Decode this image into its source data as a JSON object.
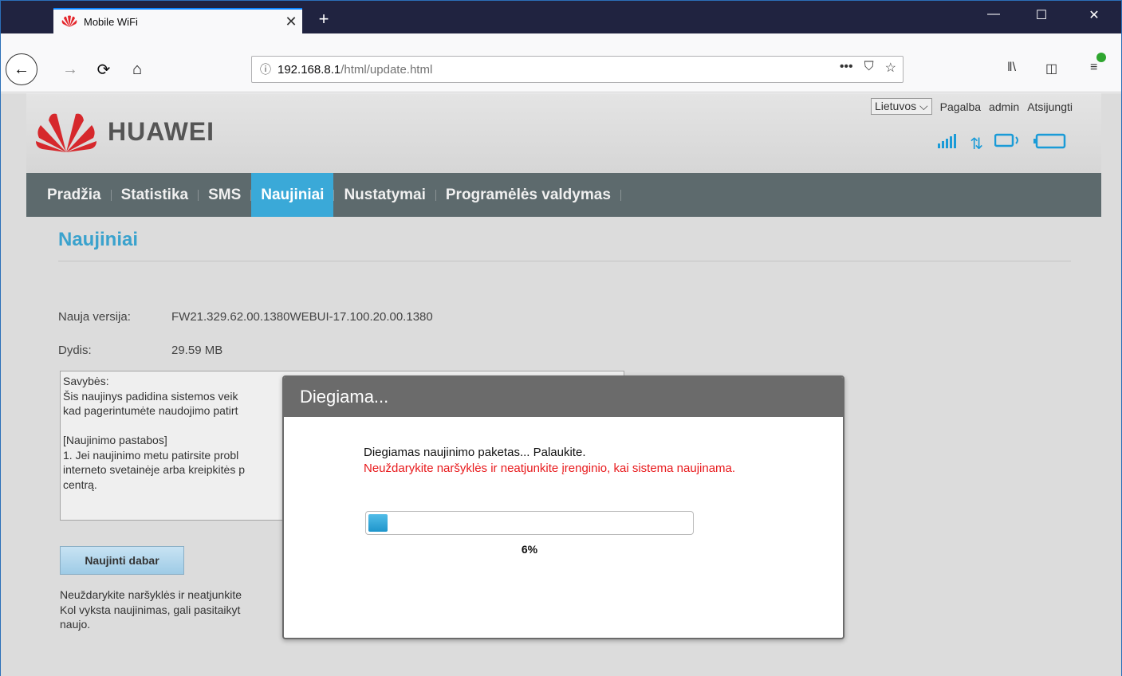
{
  "browser": {
    "tab_title": "Mobile WiFi",
    "url_host": "192.168.8.1",
    "url_path": "/html/update.html"
  },
  "router": {
    "brand": "HUAWEI",
    "language": "Lietuvos",
    "links": [
      "Pagalba",
      "admin",
      "Atsijungti"
    ],
    "menu": [
      {
        "label": "Pradžia",
        "active": false
      },
      {
        "label": "Statistika",
        "active": false
      },
      {
        "label": "SMS",
        "active": false
      },
      {
        "label": "Naujiniai",
        "active": true
      },
      {
        "label": "Nustatymai",
        "active": false
      },
      {
        "label": "Programėlės valdymas",
        "active": false
      }
    ],
    "page_title": "Naujiniai",
    "new_version_label": "Nauja versija:",
    "new_version_value": "FW21.329.62.00.1380WEBUI-17.100.20.00.1380",
    "size_label": "Dydis:",
    "size_value": "29.59 MB",
    "features_text": "Savybės:\nŠis naujinys padidina sistemos veik\nkad pagerintumėte naudojimo patirt\n\n[Naujinimo pastabos]\n1. Jei naujinimo metu patirsite probl\ninterneto svetainėje arba kreipkitės p\ncentrą.",
    "update_button": "Naujinti dabar",
    "warning_text": "Neuždarykite naršyklės ir neatjunkite\nKol vyksta naujinimas, gali pasitaikyt\nnaujo."
  },
  "modal": {
    "title": "Diegiama...",
    "message": "Diegiamas naujinimo paketas... Palaukite.",
    "warning": "Neuždarykite naršyklės ir neatjunkite įrenginio, kai sistema naujinama.",
    "progress_percent": 6,
    "progress_label": "6%"
  },
  "colors": {
    "accent": "#3aa9d8",
    "warning": "#e8191c",
    "menu_bg": "#5d6a6d"
  }
}
